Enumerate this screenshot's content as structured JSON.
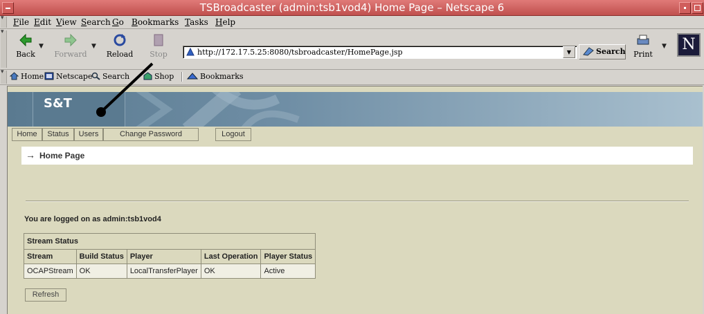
{
  "window": {
    "title": "TSBroadcaster (admin:tsb1vod4) Home Page – Netscape 6"
  },
  "menu": [
    {
      "first": "F",
      "rest": "ile"
    },
    {
      "first": "E",
      "rest": "dit"
    },
    {
      "first": "V",
      "rest": "iew"
    },
    {
      "first": "S",
      "rest": "earch"
    },
    {
      "first": "G",
      "rest": "o"
    },
    {
      "first": "B",
      "rest": "ookmarks"
    },
    {
      "first": "T",
      "rest": "asks"
    },
    {
      "first": "H",
      "rest": "elp"
    }
  ],
  "navigation": {
    "back": "Back",
    "forward": "Forward",
    "reload": "Reload",
    "stop": "Stop",
    "url": "http://172.17.5.25:8080/tsbroadcaster/HomePage.jsp",
    "search": "Search",
    "print": "Print",
    "brand_letter": "N"
  },
  "personal_toolbar": {
    "home": "Home",
    "netscape": "Netscape",
    "search": "Search",
    "shop": "Shop",
    "bookmarks": "Bookmarks"
  },
  "page": {
    "logo": "S&T",
    "tabs": [
      "Home",
      "Status",
      "Users",
      "Change Password",
      "Logout"
    ],
    "heading_arrow": "→",
    "heading": "Home Page",
    "logged_in_text": "You are logged on as admin:tsb1vod4",
    "stream_table": {
      "caption": "Stream Status",
      "headers": [
        "Stream",
        "Build Status",
        "Player",
        "Last Operation",
        "Player Status"
      ],
      "rows": [
        [
          "OCAPStream",
          "OK",
          "LocalTransferPlayer",
          "OK",
          "Active"
        ]
      ]
    },
    "refresh_button": "Refresh"
  },
  "colors": {
    "title_bar": "#c0504e",
    "chrome": "#d6d3ce",
    "page_bg": "#dbd9be",
    "banner": "#6f8ea5"
  }
}
